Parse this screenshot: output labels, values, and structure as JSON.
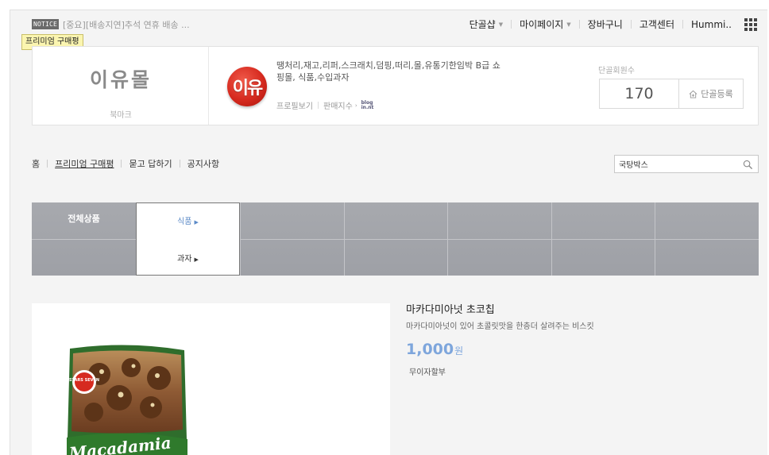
{
  "topbar": {
    "notice_badge": "NOTICE",
    "notice_text": "[중요][배송지연]추석 연휴 배송 ...",
    "tooltip": "프리미엄 구매평",
    "nav": {
      "regulars_shop": "단골샵",
      "my_page": "마이페이지",
      "cart": "장바구니",
      "customer_center": "고객센터",
      "user": "Hummi.."
    }
  },
  "shop": {
    "name": "이유몰",
    "bookmark": "북마크",
    "logo_text": "이유",
    "description": "땡처리,재고,리퍼,스크래치,덤핑,떠리,몰,유통기한임박 B급 쇼핑몰, 식품,수입과자",
    "profile_link": "프로필보기",
    "sales_index": "판매지수",
    "blog_badge": "blog in.nt",
    "regulars_label": "단골회원수",
    "regulars_count": "170",
    "regulars_button": "단골등록"
  },
  "menu": {
    "home": "홈",
    "premium_review": "프리미엄 구매평",
    "qna": "묻고 답하기",
    "notice": "공지사항",
    "search_value": "국탕박스"
  },
  "categories": {
    "all": "전체상품",
    "food": "식품",
    "snacks": "과자"
  },
  "product": {
    "title": "마카다미아넛 초코칩",
    "subtitle": "마카다미아넛이 있어 초콜릿맛을 한층더 살려주는 비스킷",
    "price": "1,000",
    "price_unit": "원",
    "installment": "무이자할부",
    "package_brand": "STARS SEVEN",
    "package_text": "Macadamia"
  },
  "colors": {
    "accent_blue": "#7ea6dc",
    "category_bar": "#a3a5aa",
    "logo_red": "#d62a1f"
  }
}
